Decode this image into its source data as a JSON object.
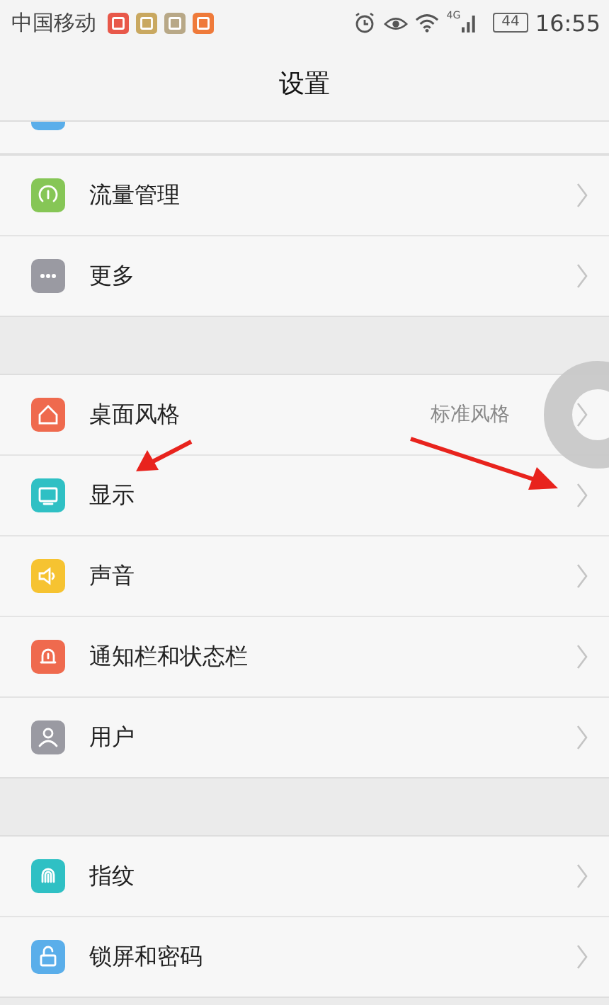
{
  "status_bar": {
    "carrier": "中国移动",
    "notifications": [
      {
        "color": "#e8584a"
      },
      {
        "color": "#c9a860"
      },
      {
        "color": "#b8a887"
      },
      {
        "color": "#ef7a3a"
      }
    ],
    "network": "4G",
    "battery": "44",
    "time": "16:55"
  },
  "header": {
    "title": "设置"
  },
  "partial_row": {
    "color": "#5aaeea"
  },
  "sections": [
    {
      "items": [
        {
          "kind": "gauge",
          "color": "#86c656",
          "label": "流量管理"
        },
        {
          "kind": "more",
          "color": "#9a9aa2",
          "label": "更多"
        }
      ]
    },
    {
      "items": [
        {
          "kind": "home",
          "color": "#ef6a4e",
          "label": "桌面风格",
          "value": "标准风格"
        },
        {
          "kind": "display",
          "color": "#2fc0c4",
          "label": "显示"
        },
        {
          "kind": "sound",
          "color": "#f6c331",
          "label": "声音"
        },
        {
          "kind": "bell",
          "color": "#ef6a4e",
          "label": "通知栏和状态栏"
        },
        {
          "kind": "user",
          "color": "#9a9aa2",
          "label": "用户"
        }
      ]
    },
    {
      "items": [
        {
          "kind": "fingerprint",
          "color": "#2fc0c4",
          "label": "指纹"
        },
        {
          "kind": "lock",
          "color": "#5aaeea",
          "label": "锁屏和密码"
        }
      ]
    }
  ]
}
